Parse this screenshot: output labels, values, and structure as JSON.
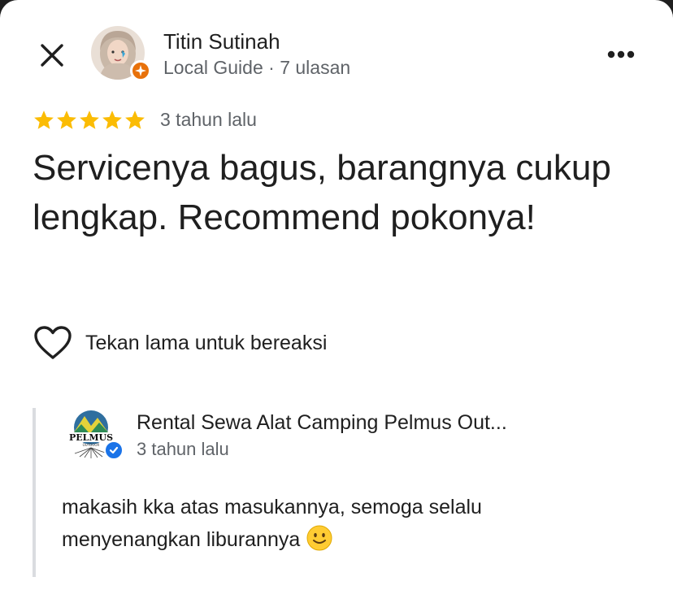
{
  "review": {
    "author_name": "Titin Sutinah",
    "author_meta": "Local Guide · 7 ulasan",
    "rating": 5,
    "rating_max": 5,
    "date": "3 tahun lalu",
    "text": "Servicenya bagus, barangnya cukup lengkap. Recommend pokonya!",
    "react_label": "Tekan lama untuk bereaksi"
  },
  "owner_reply": {
    "owner_name": "Rental Sewa Alat Camping Pelmus Out...",
    "logo_text": "PELMUS",
    "logo_subtext": "OUTDOOR",
    "date": "3 tahun lalu",
    "text": "makasih kka atas masukannya, semoga selalu menyenangkan liburannya"
  },
  "icons": {
    "close": "close-icon",
    "more": "more-vertical-icon",
    "star": "star-icon",
    "heart": "heart-outline-icon",
    "guide_badge": "local-guide-badge-icon",
    "verified": "verified-check-icon",
    "emoji": "smiling-face-emoji"
  },
  "colors": {
    "star": "#fbbc04",
    "guide_badge": "#e8710a",
    "verified": "#1a73e8",
    "text_primary": "#1f1f1f",
    "text_secondary": "#5f6368",
    "reply_border": "#dadce0"
  }
}
